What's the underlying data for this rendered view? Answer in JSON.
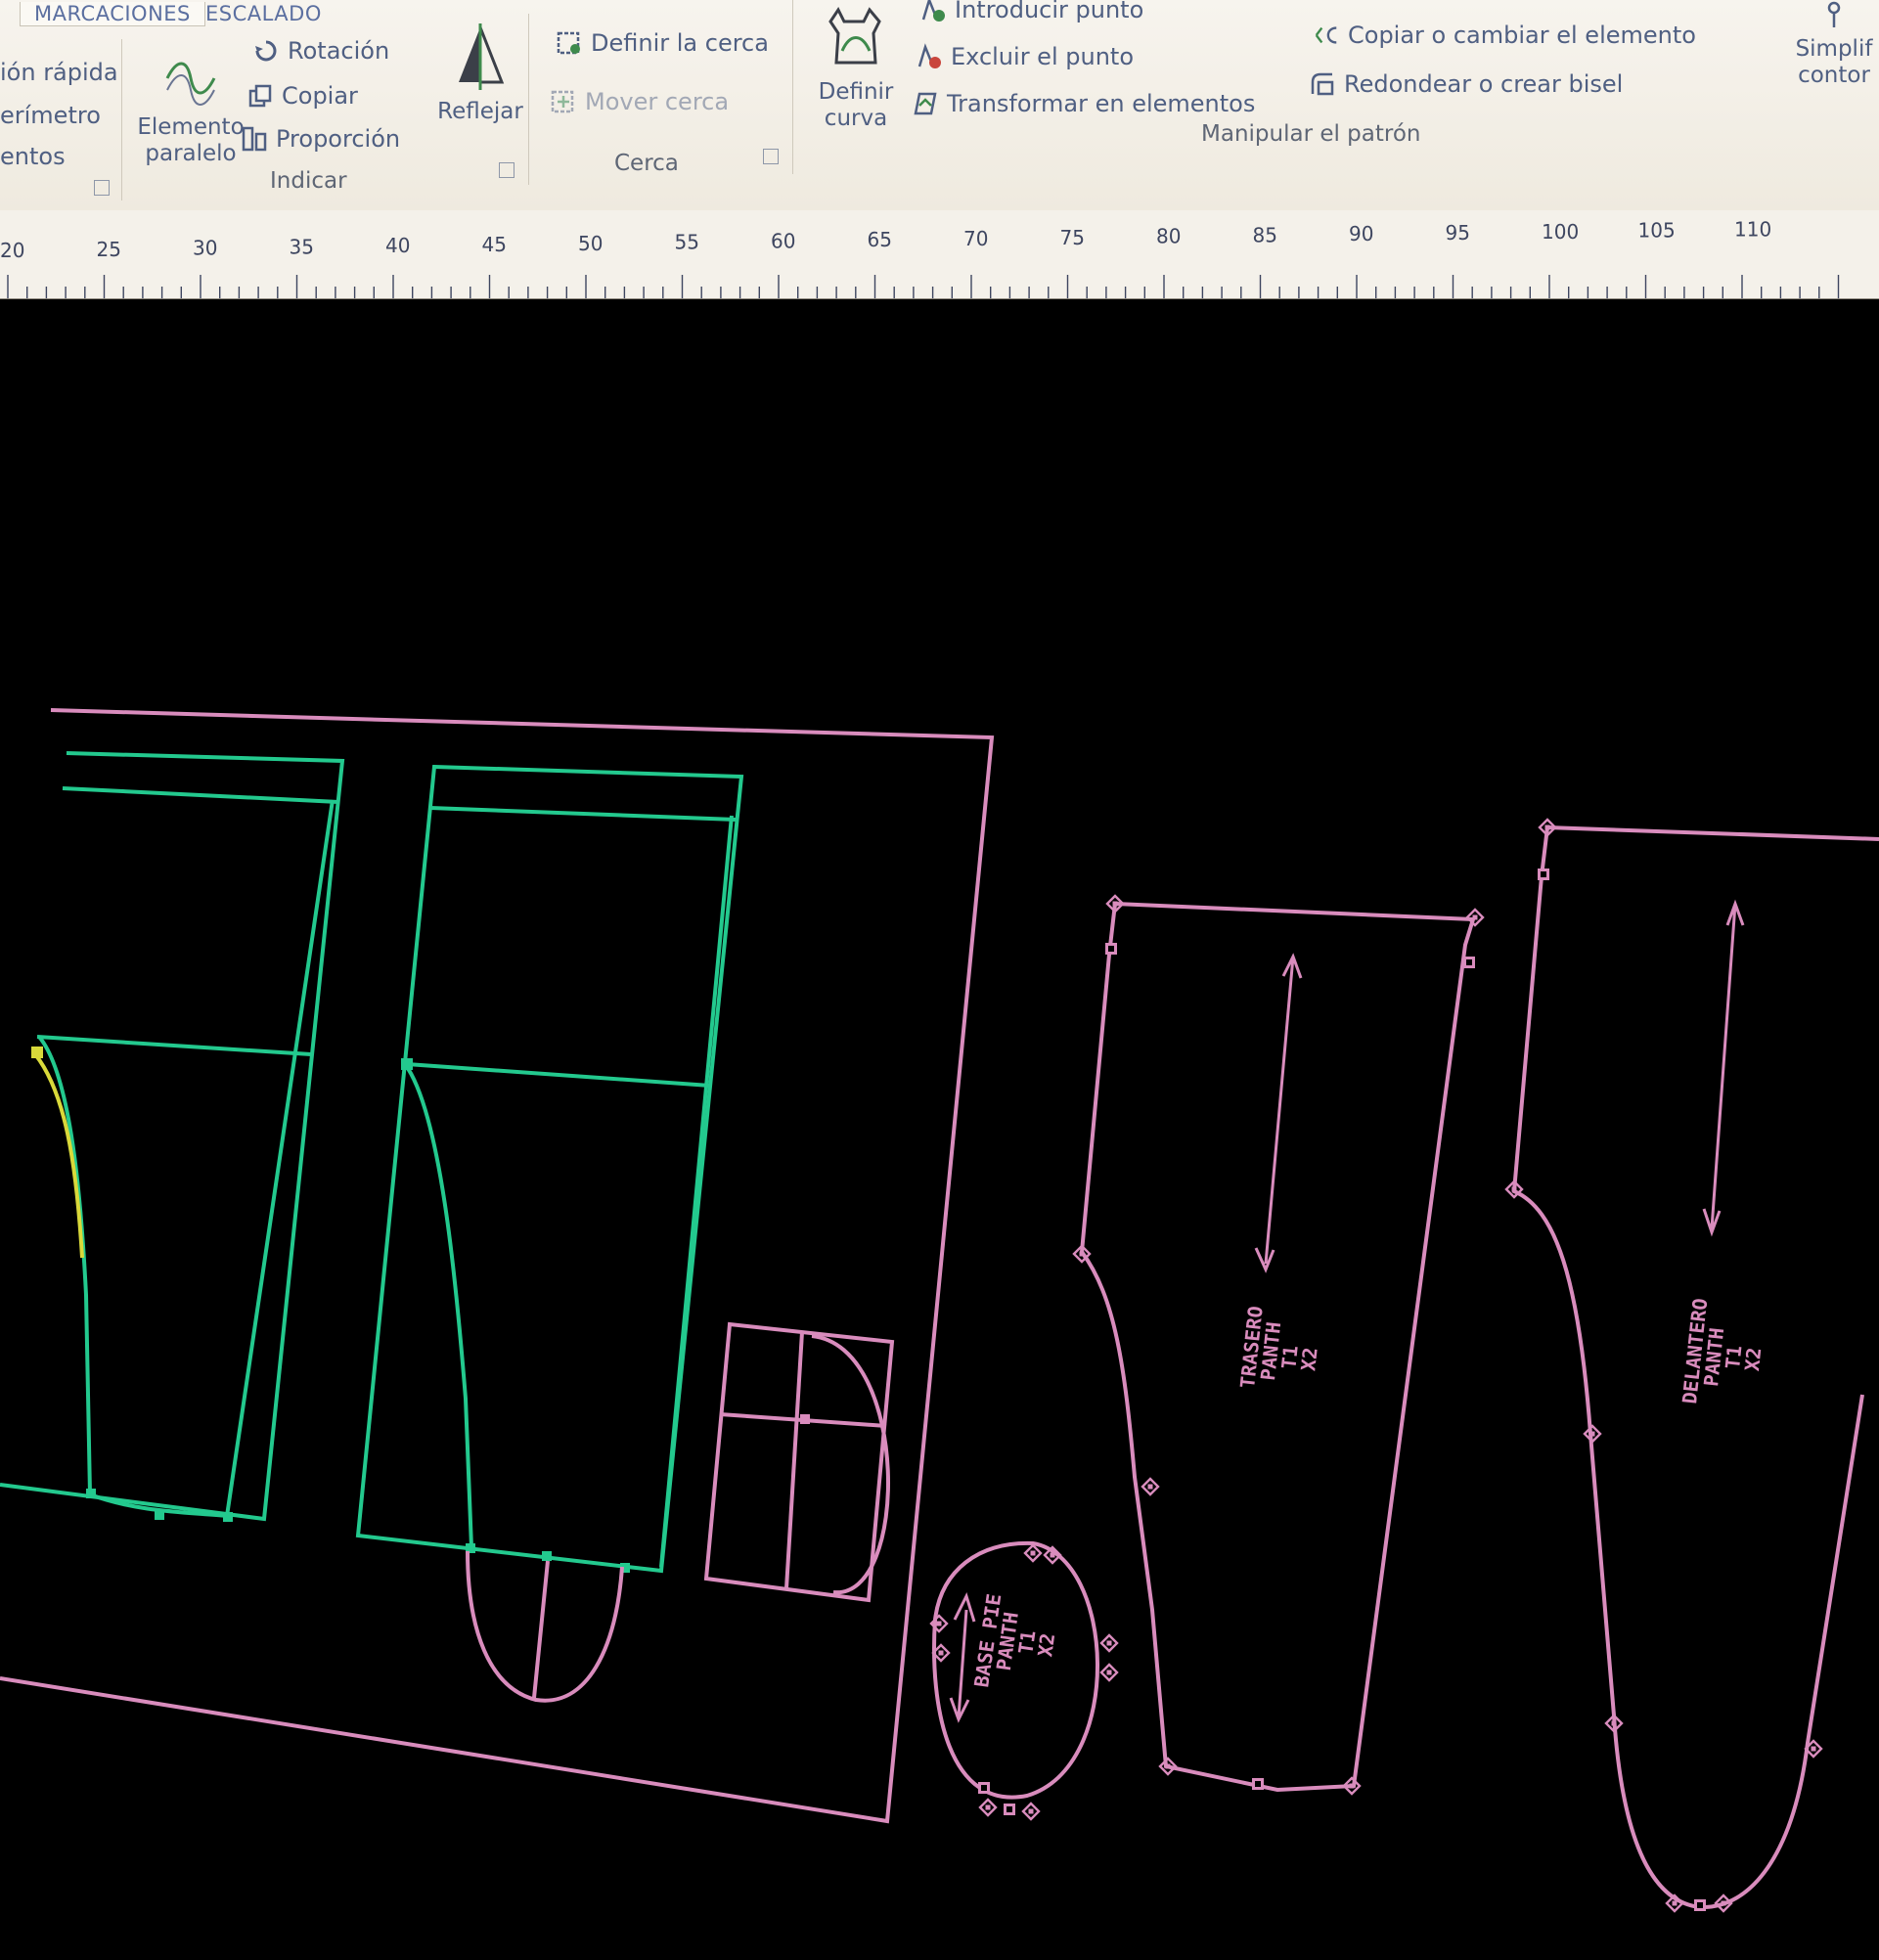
{
  "ribbon": {
    "tabs": [
      "MARCACIONES",
      "ESCALADO"
    ],
    "left_partial": [
      "ión rápida",
      "erímetro",
      "entos"
    ],
    "indicar": {
      "parallel": [
        "Elemento",
        "paralelo"
      ],
      "rotation": "Rotación",
      "copy": "Copiar",
      "proportion": "Proporción",
      "reflect": "Reflejar",
      "group": "Indicar"
    },
    "cerca": {
      "define": "Definir la cerca",
      "move": "Mover cerca",
      "group": "Cerca"
    },
    "manip": {
      "define_curve": [
        "Definir",
        "curva"
      ],
      "insert_point": "Introducir punto",
      "exclude_point": "Excluir el punto",
      "transform": "Transformar en elementos",
      "copy_change": "Copiar o cambiar el elemento",
      "round_bevel": "Redondear o crear bisel",
      "simplify": [
        "Simplif",
        "contor"
      ],
      "group": "Manipular el patrón"
    }
  },
  "ruler": {
    "ticks": [
      "20",
      "25",
      "30",
      "35",
      "40",
      "45",
      "50",
      "55",
      "60",
      "65",
      "70",
      "75",
      "80",
      "85",
      "90",
      "95",
      "100",
      "105",
      "110"
    ]
  },
  "pieces": {
    "small": [
      "BASE PIE",
      "PANTH",
      "T1",
      "X2"
    ],
    "back": [
      "TRASERO",
      "PANTH",
      "T1",
      "X2"
    ],
    "front": [
      "DELANTERO",
      "PANTH",
      "T1",
      "X2"
    ]
  },
  "colors": {
    "pink": "#d98cbd",
    "green": "#23c98e",
    "yellow": "#d9d93a",
    "ribbon_text": "#4f5f82"
  }
}
